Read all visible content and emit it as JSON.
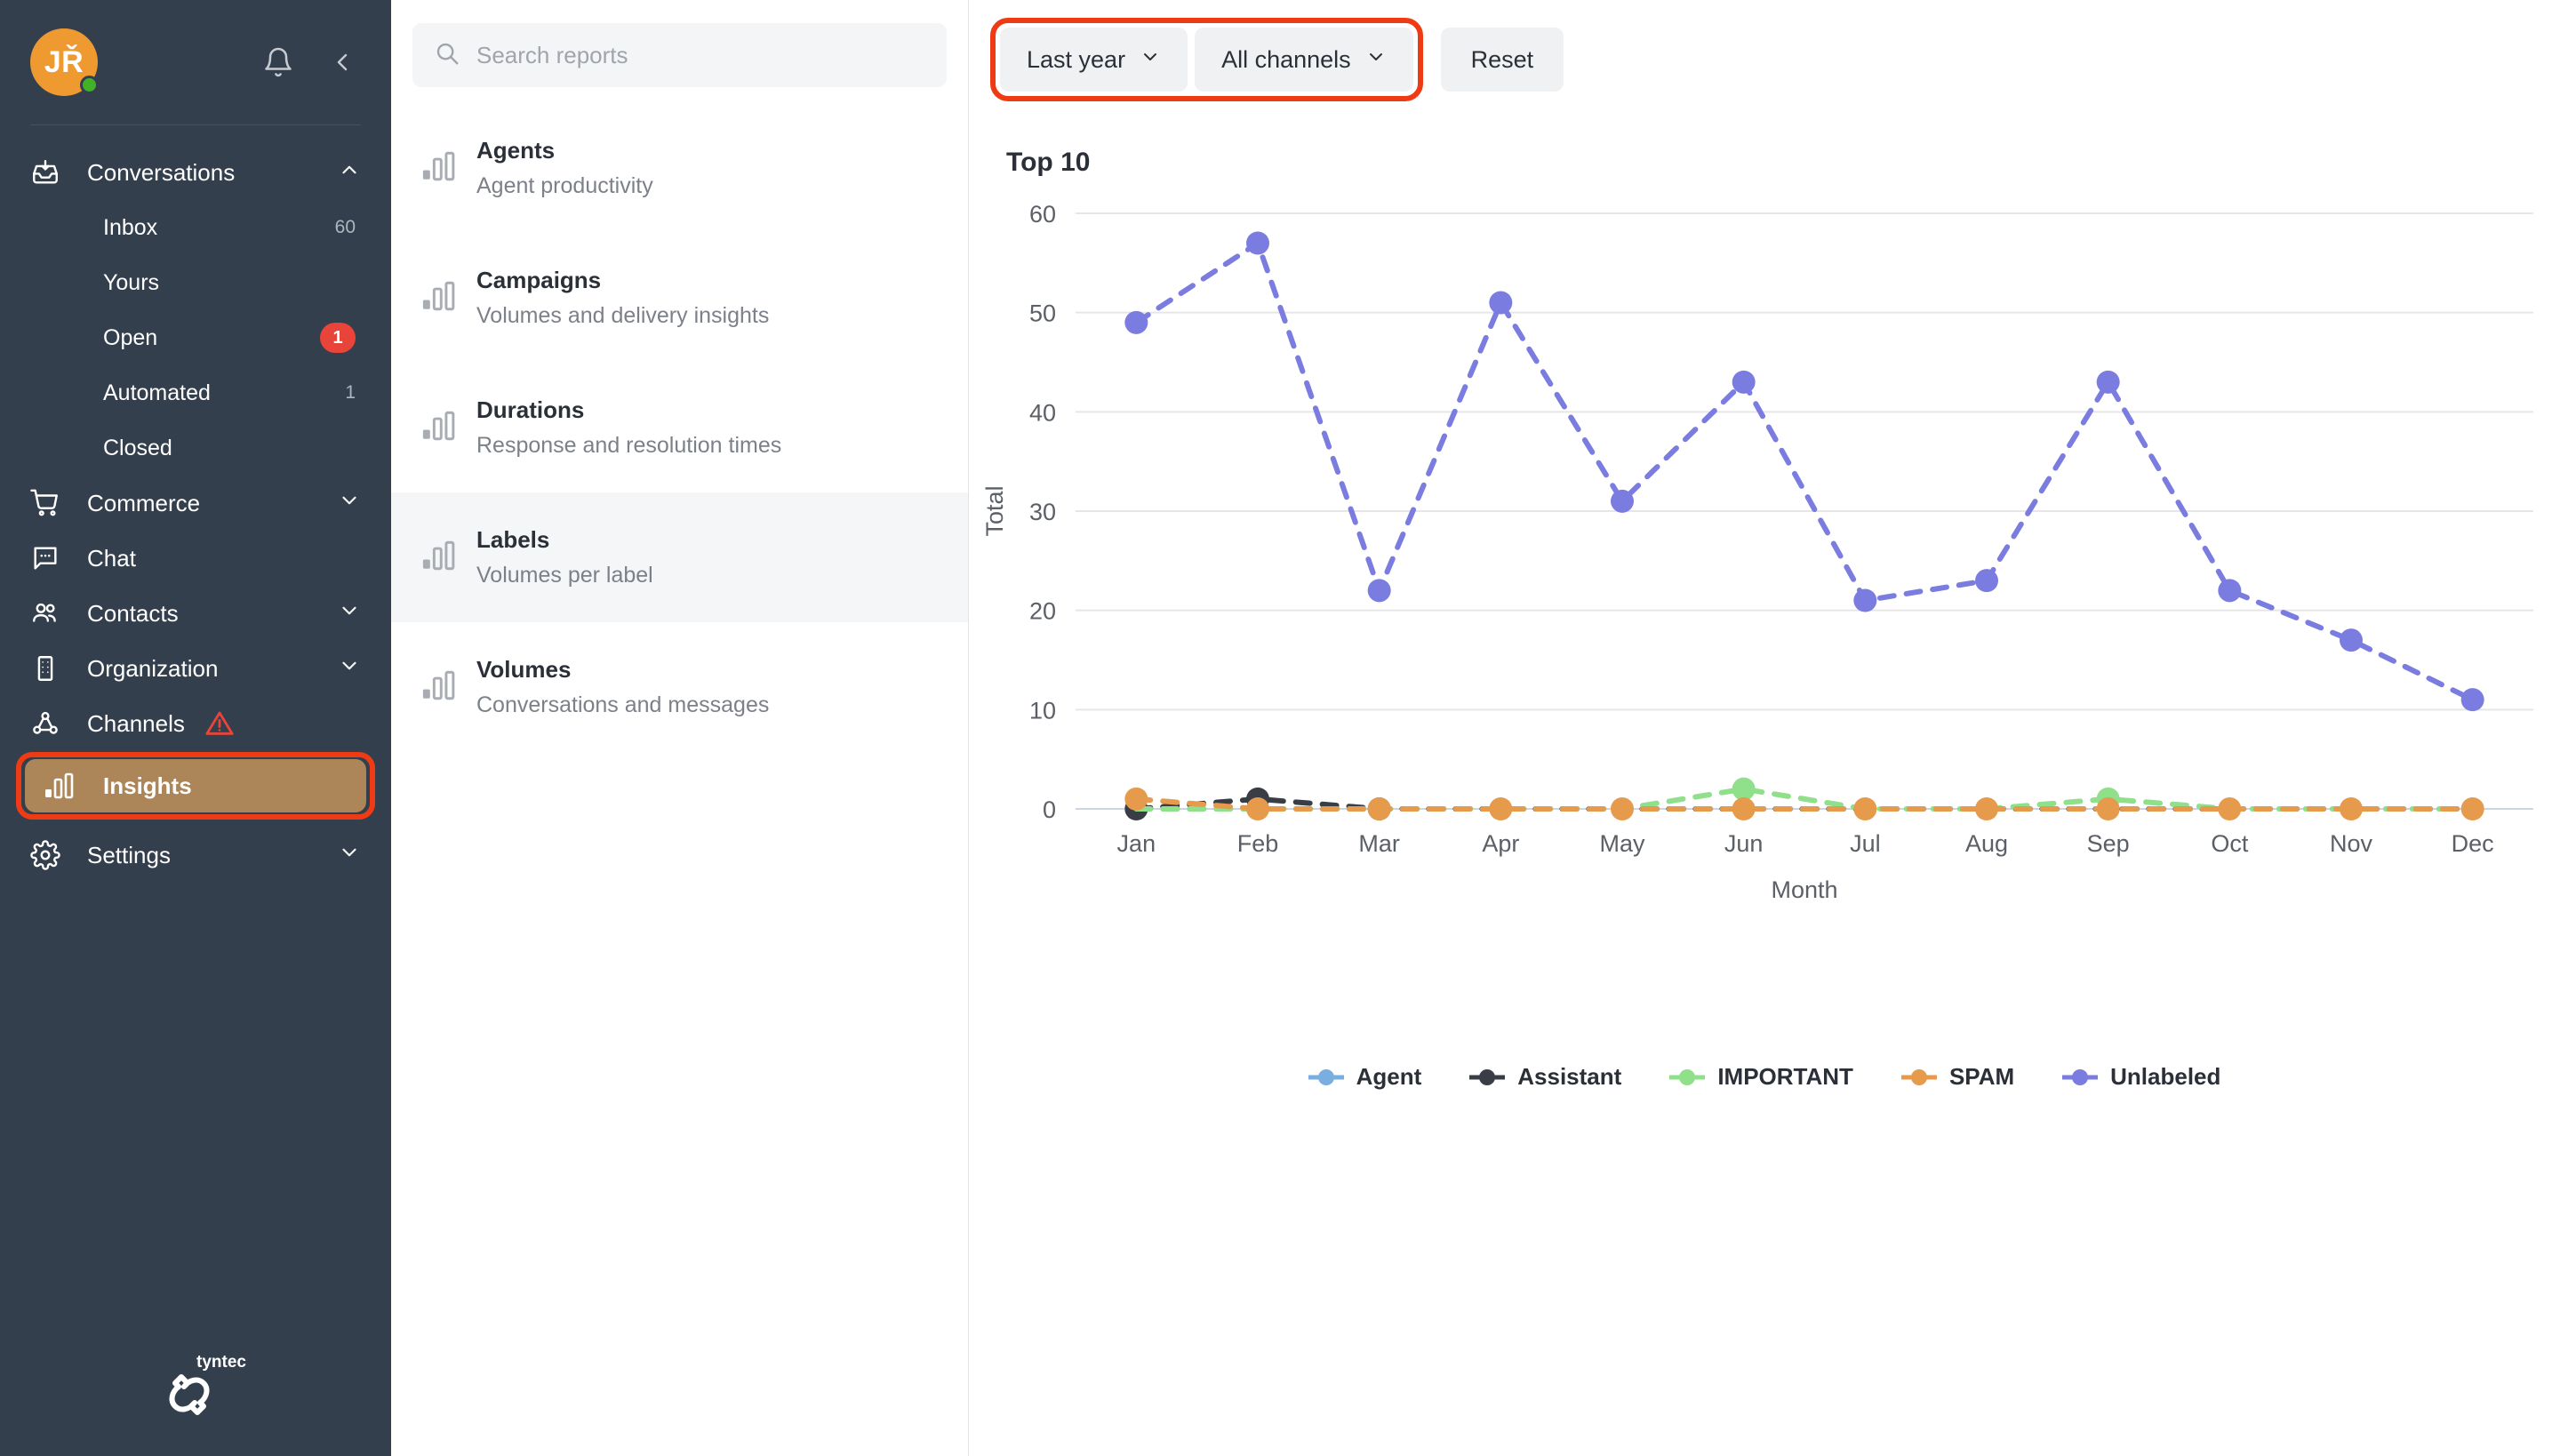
{
  "sidebar": {
    "avatar_initials": "JŘ",
    "bell_icon": "bell-icon",
    "collapse_icon": "chevron-left-icon",
    "groups": [
      {
        "label": "Conversations",
        "icon": "inbox-tray-icon",
        "chevron": "chevron-up-icon"
      }
    ],
    "conversation_items": [
      {
        "label": "Inbox",
        "count": "60",
        "badge": false
      },
      {
        "label": "Yours",
        "count": "",
        "badge": false
      },
      {
        "label": "Open",
        "count": "1",
        "badge": true
      },
      {
        "label": "Automated",
        "count": "1",
        "badge": false
      },
      {
        "label": "Closed",
        "count": "",
        "badge": false
      }
    ],
    "items": [
      {
        "label": "Commerce",
        "icon": "shopping-cart-icon",
        "chevron": "chevron-down-icon",
        "warning": false
      },
      {
        "label": "Chat",
        "icon": "chat-bubble-icon",
        "chevron": "",
        "warning": false
      },
      {
        "label": "Contacts",
        "icon": "people-icon",
        "chevron": "chevron-down-icon",
        "warning": false
      },
      {
        "label": "Organization",
        "icon": "building-icon",
        "chevron": "chevron-down-icon",
        "warning": false
      },
      {
        "label": "Channels",
        "icon": "nodes-icon",
        "chevron": "",
        "warning": true
      }
    ],
    "active_item": {
      "label": "Insights",
      "icon": "bar-chart-icon"
    },
    "settings_item": {
      "label": "Settings",
      "icon": "gear-icon",
      "chevron": "chevron-down-icon"
    },
    "logo_text": "tyntec",
    "colors": {
      "background": "#343f4d",
      "avatar": "#ef9a31",
      "presence": "#43b02a",
      "badge": "#e8443a",
      "active_fill": "#ac8559",
      "highlight_outline": "#ef3b14",
      "warning": "#e8443a"
    }
  },
  "reports": {
    "search": {
      "placeholder": "Search reports",
      "icon": "search-icon"
    },
    "items": [
      {
        "title": "Agents",
        "subtitle": "Agent productivity",
        "icon": "bar-chart-icon",
        "selected": false
      },
      {
        "title": "Campaigns",
        "subtitle": "Volumes and delivery insights",
        "icon": "bar-chart-icon",
        "selected": false
      },
      {
        "title": "Durations",
        "subtitle": "Response and resolution times",
        "icon": "bar-chart-icon",
        "selected": false
      },
      {
        "title": "Labels",
        "subtitle": "Volumes per label",
        "icon": "bar-chart-icon",
        "selected": true
      },
      {
        "title": "Volumes",
        "subtitle": "Conversations and messages",
        "icon": "bar-chart-icon",
        "selected": false
      }
    ]
  },
  "toolbar": {
    "date_filter": {
      "label": "Last year",
      "icon": "chevron-down-icon"
    },
    "channel_filter": {
      "label": "All channels",
      "icon": "chevron-down-icon"
    },
    "reset_label": "Reset",
    "highlight_color": "#ef3b14"
  },
  "chart_data": {
    "type": "line",
    "title": "Top 10",
    "xlabel": "Month",
    "ylabel": "Total",
    "categories": [
      "Jan",
      "Feb",
      "Mar",
      "Apr",
      "May",
      "Jun",
      "Jul",
      "Aug",
      "Sep",
      "Oct",
      "Nov",
      "Dec"
    ],
    "ylim": [
      0,
      60
    ],
    "yticks": [
      0,
      10,
      20,
      30,
      40,
      50,
      60
    ],
    "grid": true,
    "legend_position": "bottom",
    "line_style": "dashed",
    "series": [
      {
        "name": "Agent",
        "color": "#7aaee0",
        "values": [
          0,
          0,
          0,
          0,
          0,
          0,
          0,
          0,
          0,
          0,
          0,
          0
        ]
      },
      {
        "name": "Assistant",
        "color": "#393e46",
        "values": [
          0,
          1,
          0,
          0,
          0,
          0,
          0,
          0,
          0,
          0,
          0,
          0
        ]
      },
      {
        "name": "IMPORTANT",
        "color": "#90e08b",
        "values": [
          0,
          0,
          0,
          0,
          0,
          2,
          0,
          0,
          1,
          0,
          0,
          0
        ]
      },
      {
        "name": "SPAM",
        "color": "#e69a4c",
        "values": [
          1,
          0,
          0,
          0,
          0,
          0,
          0,
          0,
          0,
          0,
          0,
          0
        ]
      },
      {
        "name": "Unlabeled",
        "color": "#7b7ce0",
        "values": [
          49,
          57,
          22,
          51,
          31,
          43,
          21,
          23,
          43,
          22,
          17,
          11
        ]
      }
    ]
  }
}
